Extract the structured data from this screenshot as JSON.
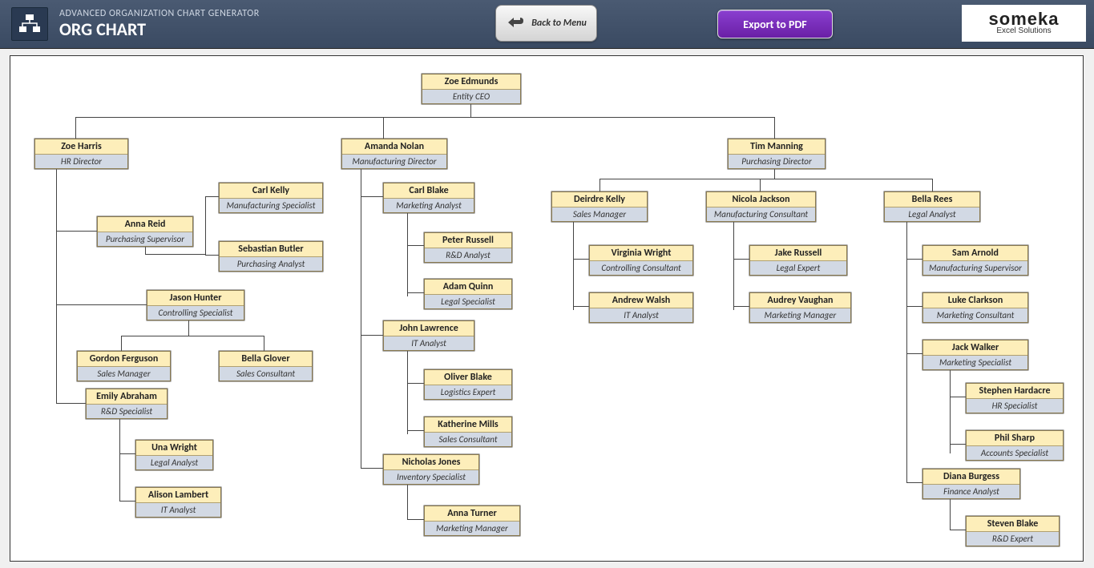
{
  "header": {
    "subTitle": "ADVANCED ORGANIZATION CHART GENERATOR",
    "mainTitle": "ORG CHART",
    "backLabel": "Back to Menu",
    "exportLabel": "Export to PDF",
    "brandName": "someka",
    "brandSub": "Excel Solutions"
  },
  "nodes": {
    "ceo": {
      "name": "Zoe Edmunds",
      "role": "Entity CEO"
    },
    "hr": {
      "name": "Zoe Harris",
      "role": "HR Director"
    },
    "mfg": {
      "name": "Amanda Nolan",
      "role": "Manufacturing Director"
    },
    "pur": {
      "name": "Tim Manning",
      "role": "Purchasing Director"
    },
    "anna_reid": {
      "name": "Anna Reid",
      "role": "Purchasing Supervisor"
    },
    "carl_kelly": {
      "name": "Carl Kelly",
      "role": "Manufacturing Specialist"
    },
    "sebastian": {
      "name": "Sebastian Butler",
      "role": "Purchasing Analyst"
    },
    "jason": {
      "name": "Jason Hunter",
      "role": "Controlling Specialist"
    },
    "gordon": {
      "name": "Gordon Ferguson",
      "role": "Sales Manager"
    },
    "bella_g": {
      "name": "Bella Glover",
      "role": "Sales Consultant"
    },
    "emily": {
      "name": "Emily Abraham",
      "role": "R&D Specialist"
    },
    "una": {
      "name": "Una Wright",
      "role": "Legal Analyst"
    },
    "alison": {
      "name": "Alison Lambert",
      "role": "IT Analyst"
    },
    "carl_b": {
      "name": "Carl Blake",
      "role": "Marketing Analyst"
    },
    "peter": {
      "name": "Peter Russell",
      "role": "R&D Analyst"
    },
    "adam": {
      "name": "Adam Quinn",
      "role": "Legal Specialist"
    },
    "john_l": {
      "name": "John Lawrence",
      "role": "IT Analyst"
    },
    "oliver": {
      "name": "Oliver Blake",
      "role": "Logistics Expert"
    },
    "katherine": {
      "name": "Katherine Mills",
      "role": "Sales Consultant"
    },
    "nicholas": {
      "name": "Nicholas Jones",
      "role": "Inventory Specialist"
    },
    "anna_t": {
      "name": "Anna Turner",
      "role": "Marketing Manager"
    },
    "deirdre": {
      "name": "Deirdre Kelly",
      "role": "Sales Manager"
    },
    "virginia": {
      "name": "Virginia Wright",
      "role": "Controlling Consultant"
    },
    "andrew": {
      "name": "Andrew Walsh",
      "role": "IT Analyst"
    },
    "nicola": {
      "name": "Nicola Jackson",
      "role": "Manufacturing Consultant"
    },
    "jake": {
      "name": "Jake Russell",
      "role": "Legal Expert"
    },
    "audrey": {
      "name": "Audrey Vaughan",
      "role": "Marketing Manager"
    },
    "bella_r": {
      "name": "Bella Rees",
      "role": "Legal Analyst"
    },
    "sam": {
      "name": "Sam Arnold",
      "role": "Manufacturing Supervisor"
    },
    "luke": {
      "name": "Luke Clarkson",
      "role": "Marketing Consultant"
    },
    "jack": {
      "name": "Jack Walker",
      "role": "Marketing Specialist"
    },
    "stephen": {
      "name": "Stephen Hardacre",
      "role": "HR Specialist"
    },
    "phil": {
      "name": "Phil Sharp",
      "role": "Accounts Specialist"
    },
    "diana": {
      "name": "Diana Burgess",
      "role": "Finance Analyst"
    },
    "steven_b": {
      "name": "Steven Blake",
      "role": "R&D Expert"
    }
  }
}
